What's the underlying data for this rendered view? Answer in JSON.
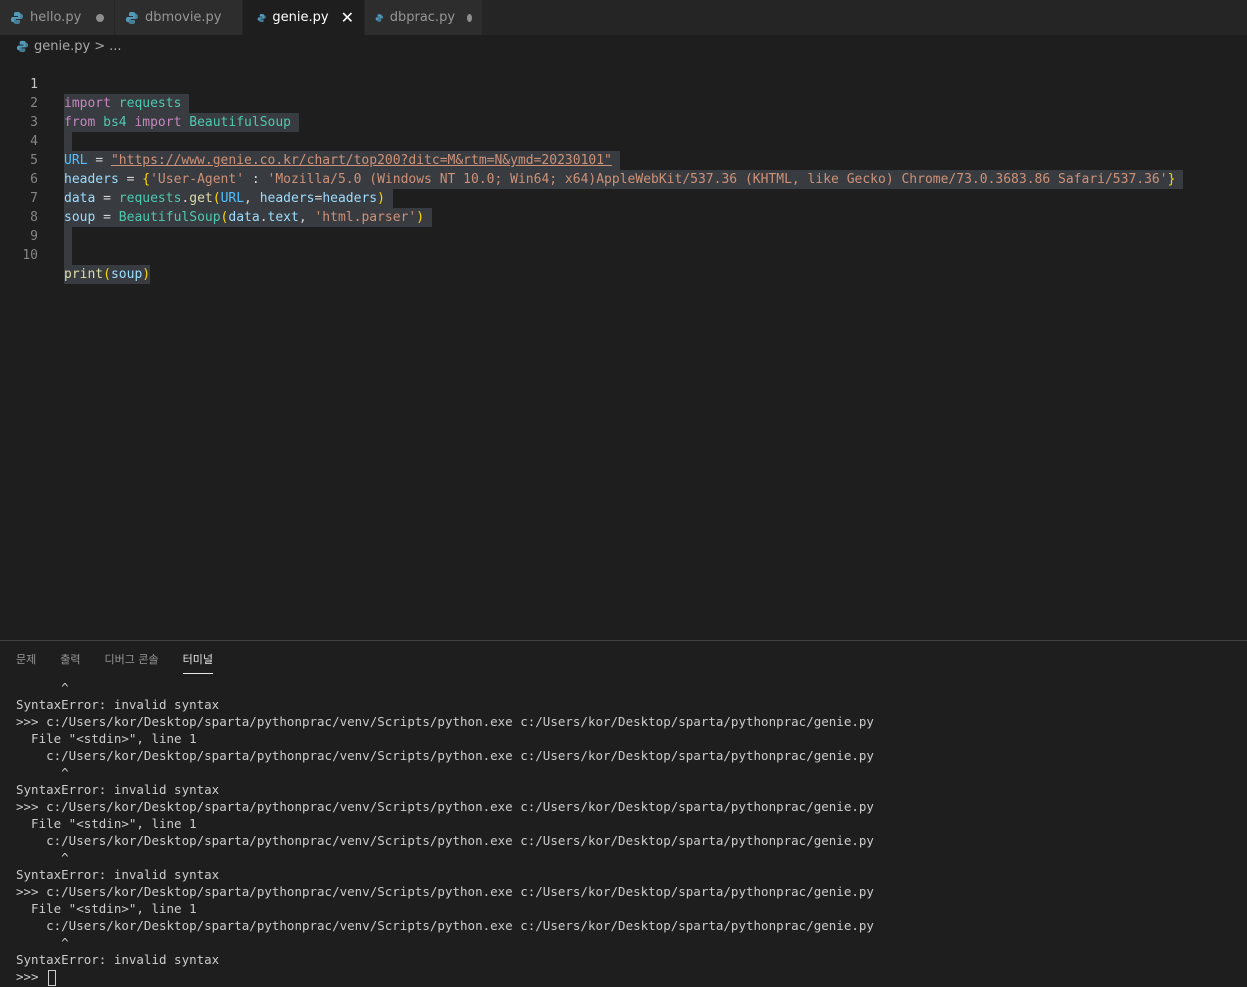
{
  "tabs": [
    {
      "label": "hello.py",
      "state": "modified"
    },
    {
      "label": "dbmovie.py",
      "state": "clean"
    },
    {
      "label": "genie.py",
      "state": "active"
    },
    {
      "label": "dbprac.py",
      "state": "modified"
    }
  ],
  "breadcrumb": {
    "file": "genie.py",
    "separator": ">",
    "more": "..."
  },
  "editor": {
    "current_line": "1",
    "line_numbers": [
      "1",
      "2",
      "3",
      "4",
      "5",
      "6",
      "7",
      "8",
      "9",
      "10"
    ],
    "tokens": {
      "l1_import": "import",
      "l1_requests": "requests",
      "l2_from": "from",
      "l2_bs4": "bs4",
      "l2_import": "import",
      "l2_bs": "BeautifulSoup",
      "l4_url": "URL",
      "l4_eq": "=",
      "l4_str": "\"https://www.genie.co.kr/chart/top200?ditc=M&rtm=N&ymd=20230101\"",
      "l5_headers": "headers",
      "l5_eq": "=",
      "l5_ob": "{",
      "l5_key": "'User-Agent'",
      "l5_colon": ":",
      "l5_val": "'Mozilla/5.0 (Windows NT 10.0; Win64; x64)AppleWebKit/537.36 (KHTML, like Gecko) Chrome/73.0.3683.86 Safari/537.36'",
      "l5_cb": "}",
      "l6_data": "data",
      "l6_eq": "=",
      "l6_requests": "requests",
      "l6_dot": ".",
      "l6_get": "get",
      "l6_op": "(",
      "l6_url": "URL",
      "l6_comma": ",",
      "l6_hk": "headers",
      "l6_eq2": "=",
      "l6_hv": "headers",
      "l6_cp": ")",
      "l7_soup": "soup",
      "l7_eq": "=",
      "l7_bs": "BeautifulSoup",
      "l7_op": "(",
      "l7_data": "data",
      "l7_dot": ".",
      "l7_text": "text",
      "l7_comma": ",",
      "l7_str": "'html.parser'",
      "l7_cp": ")",
      "l10_print": "print",
      "l10_op": "(",
      "l10_soup": "soup",
      "l10_cp": ")"
    }
  },
  "panel": {
    "tabs": [
      "문제",
      "출력",
      "디버그 콘솔",
      "터미널"
    ],
    "active_tab": "터미널",
    "terminal_lines": [
      "      ^",
      "SyntaxError: invalid syntax",
      ">>> c:/Users/kor/Desktop/sparta/pythonprac/venv/Scripts/python.exe c:/Users/kor/Desktop/sparta/pythonprac/genie.py",
      "  File \"<stdin>\", line 1",
      "    c:/Users/kor/Desktop/sparta/pythonprac/venv/Scripts/python.exe c:/Users/kor/Desktop/sparta/pythonprac/genie.py",
      "      ^",
      "SyntaxError: invalid syntax",
      ">>> c:/Users/kor/Desktop/sparta/pythonprac/venv/Scripts/python.exe c:/Users/kor/Desktop/sparta/pythonprac/genie.py",
      "  File \"<stdin>\", line 1",
      "    c:/Users/kor/Desktop/sparta/pythonprac/venv/Scripts/python.exe c:/Users/kor/Desktop/sparta/pythonprac/genie.py",
      "      ^",
      "SyntaxError: invalid syntax",
      ">>> c:/Users/kor/Desktop/sparta/pythonprac/venv/Scripts/python.exe c:/Users/kor/Desktop/sparta/pythonprac/genie.py",
      "  File \"<stdin>\", line 1",
      "    c:/Users/kor/Desktop/sparta/pythonprac/venv/Scripts/python.exe c:/Users/kor/Desktop/sparta/pythonprac/genie.py",
      "      ^",
      "SyntaxError: invalid syntax"
    ],
    "prompt": ">>>"
  },
  "colors": {
    "background": "#1e1e1e",
    "tab_inactive": "#2d2d2d",
    "keyword": "#c586c0",
    "class": "#4ec9b0",
    "string": "#ce9178",
    "function": "#dcdcaa",
    "variable": "#9cdcfe"
  },
  "icons": {
    "file": "python-file-icon",
    "modified": "modified-dot-icon",
    "close": "close-icon"
  }
}
